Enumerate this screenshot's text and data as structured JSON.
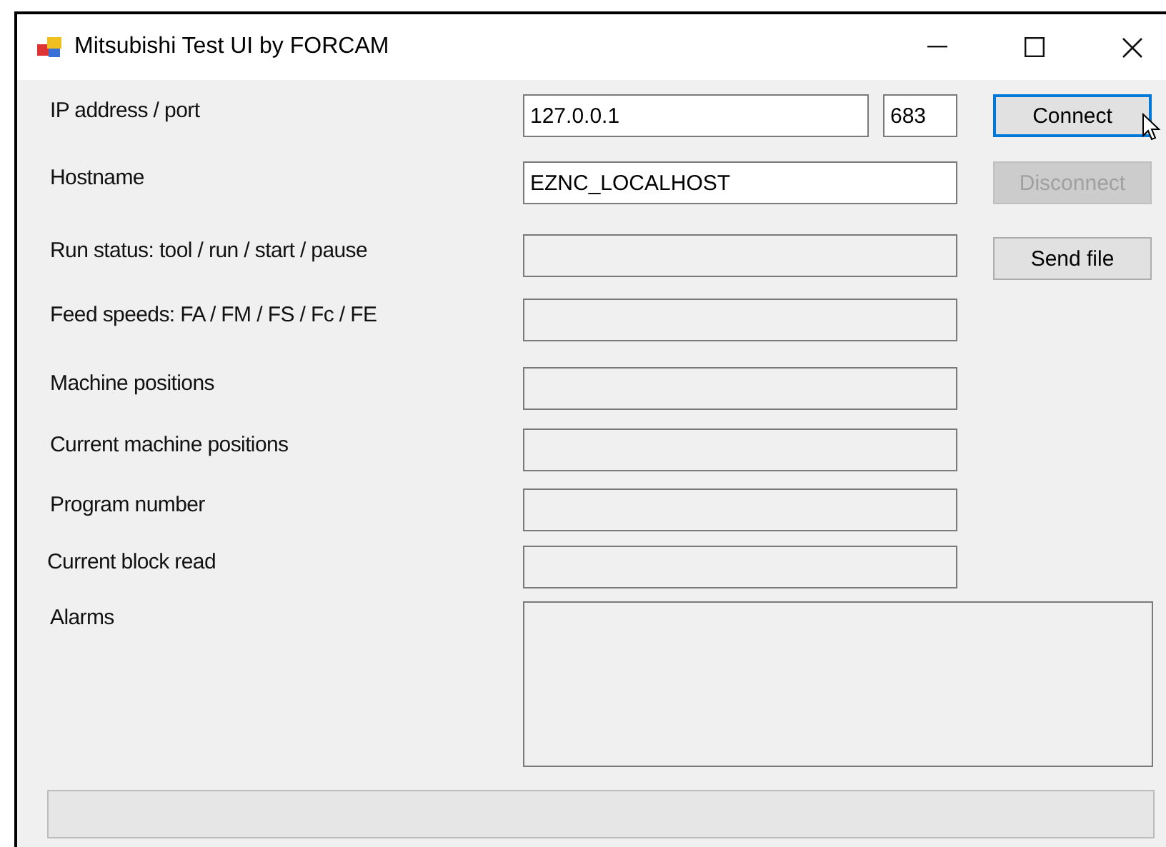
{
  "window": {
    "title": "Mitsubishi Test UI by FORCAM"
  },
  "rows": [
    {
      "label": "IP address / port",
      "kind": "text",
      "value": "127.0.0.1",
      "readonly": false,
      "port": "683"
    },
    {
      "label": "Hostname",
      "kind": "text",
      "value": "EZNC_LOCALHOST",
      "readonly": false
    },
    {
      "label": "Run status: tool / run / start / pause",
      "kind": "text",
      "readonly": true
    },
    {
      "label": "Feed speeds: FA / FM / FS / Fc / FE",
      "kind": "text",
      "readonly": true
    },
    {
      "label": "Machine positions",
      "kind": "text",
      "readonly": true
    },
    {
      "label": "Current machine positions",
      "kind": "text",
      "readonly": true
    },
    {
      "label": "Program number",
      "kind": "text",
      "readonly": true
    },
    {
      "label": "Current block read",
      "kind": "text",
      "readonly": true
    },
    {
      "label": "Alarms",
      "kind": "multiline",
      "readonly": true
    }
  ],
  "buttons": [
    {
      "label": "Connect",
      "disabled": false,
      "focused": true
    },
    {
      "label": "Disconnect",
      "disabled": true,
      "focused": false
    },
    {
      "label": "Send file",
      "disabled": false,
      "focused": false
    }
  ],
  "progress": {
    "level": 0
  }
}
